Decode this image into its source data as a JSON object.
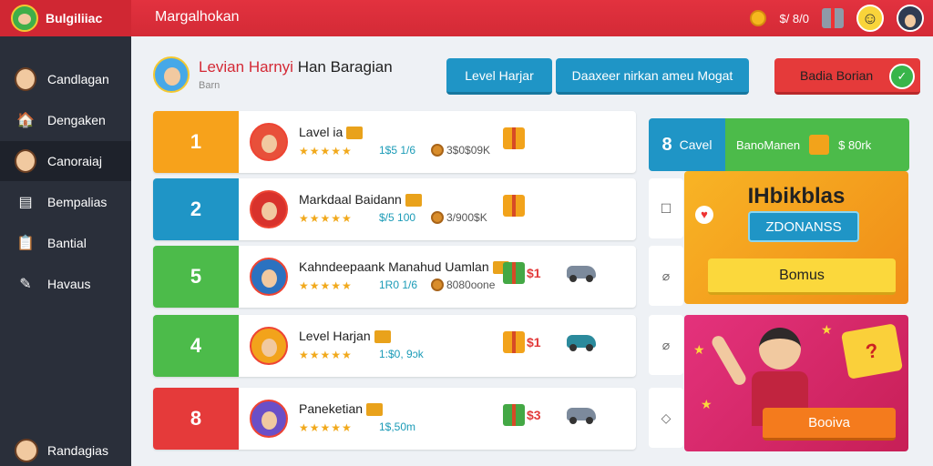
{
  "topbar": {
    "logo_text": "Bulgiliiac",
    "title": "Margalhokan",
    "amount": "$/ 8/0"
  },
  "sidebar": {
    "items": [
      {
        "label": "Candlagan",
        "icon": "avatar-icon"
      },
      {
        "label": "Dengaken",
        "icon": "house-icon"
      },
      {
        "label": "Canoraiaj",
        "icon": "avatar-icon"
      },
      {
        "label": "Bempalias",
        "icon": "document-icon"
      },
      {
        "label": "Bantial",
        "icon": "clipboard-icon"
      },
      {
        "label": "Havaus",
        "icon": "edit-icon"
      }
    ],
    "bottom_label": "Randagias"
  },
  "header": {
    "title_red": "Levian Harnyi",
    "title_dark": "Han Baragian",
    "subtitle": "Barn"
  },
  "buttons": {
    "level": "Level Harjar",
    "search": "Daaxeer nirkan ameu Mogat",
    "bonus": "Badia Borian"
  },
  "leaderboard": [
    {
      "rank": "1",
      "name": "Lavel ia",
      "score": "1$5 1/6",
      "extra": "3$0$09K",
      "rank_color": "#f7a21b",
      "avatar_color": "#e8503a"
    },
    {
      "rank": "2",
      "name": "Markdaal Baidann",
      "score": "$/5 100",
      "extra": "3/900$K",
      "rank_color": "#1f95c6",
      "avatar_color": "#d8322c"
    },
    {
      "rank": "5",
      "name": "Kahndeepaank Manahud Uamlan",
      "score": "1R0 1/6",
      "extra": "8080oone",
      "reward": "$1",
      "rank_color": "#4cbb4a",
      "avatar_color": "#2b72c0"
    },
    {
      "rank": "4",
      "name": "Level Harjan",
      "score": "1:$0, 9ɔk",
      "reward": "$1",
      "rank_color": "#4cbb4a",
      "avatar_color": "#f2a31b"
    },
    {
      "rank": "8",
      "name": "Paneketian",
      "score": "1$,50m",
      "reward": "$3",
      "rank_color": "#e53a3a",
      "avatar_color": "#6a4fc7"
    }
  ],
  "level_card": {
    "number": "8",
    "label": "Cavel",
    "name": "BanoManen",
    "value": "$ 80rk"
  },
  "bonus_card": {
    "title": "IHbikblas",
    "chip": "ZDONANSS",
    "button": "Bomus"
  },
  "promo_card": {
    "badge": "?",
    "button": "Booiva"
  },
  "colors": {
    "topbar": "#d42a36",
    "sidebar": "#2a2f3a",
    "accent_blue": "#1f95c6",
    "accent_green": "#4cbb4a",
    "accent_orange": "#f7a21b"
  }
}
